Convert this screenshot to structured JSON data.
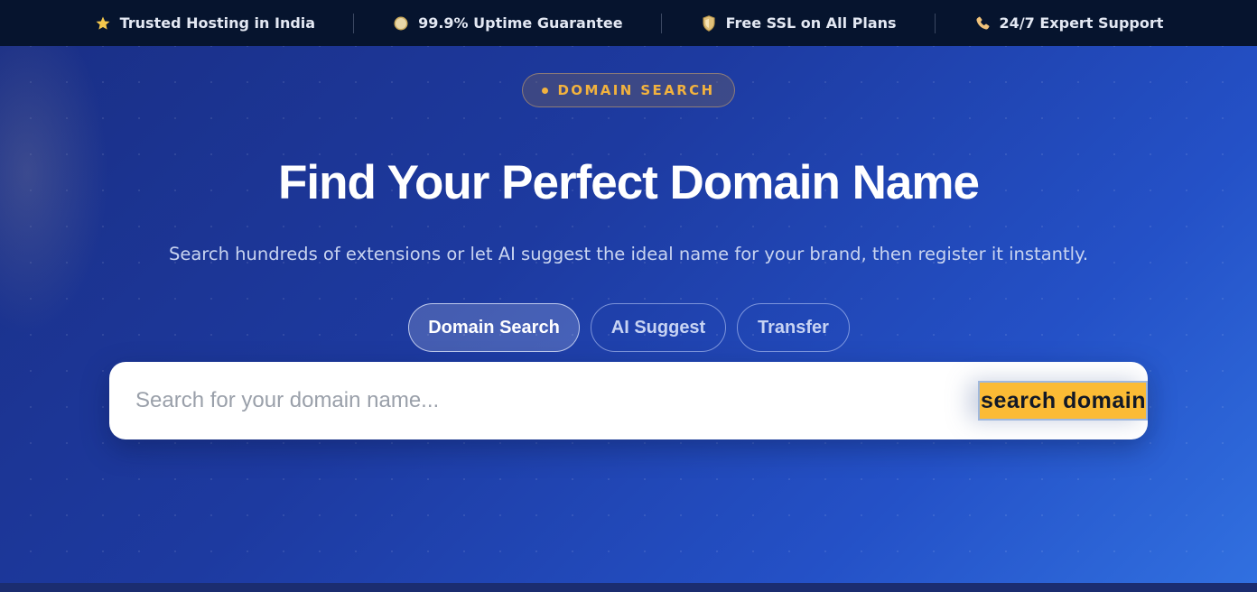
{
  "topbar": {
    "items": [
      {
        "icon": "star-icon",
        "label": "Trusted Hosting in India"
      },
      {
        "icon": "uptime-icon",
        "label": "99.9% Uptime Guarantee"
      },
      {
        "icon": "shield-icon",
        "label": "Free SSL on All Plans"
      },
      {
        "icon": "phone-icon",
        "label": "24/7 Expert Support"
      }
    ]
  },
  "hero": {
    "badge": "DOMAIN SEARCH",
    "title": "Find Your Perfect Domain Name",
    "subtitle": "Search hundreds of extensions or let AI suggest the ideal name for your brand, then register it instantly.",
    "tabs": [
      {
        "label": "Domain Search",
        "active": true
      },
      {
        "label": "AI Suggest",
        "active": false
      },
      {
        "label": "Transfer",
        "active": false
      }
    ],
    "search": {
      "placeholder": "Search for your domain name...",
      "value": "",
      "button_label": "search domain"
    }
  },
  "colors": {
    "accent": "#fbbb35",
    "topbar_bg": "#06142e",
    "hero_start": "#1a2f86",
    "hero_end": "#3170e0"
  }
}
